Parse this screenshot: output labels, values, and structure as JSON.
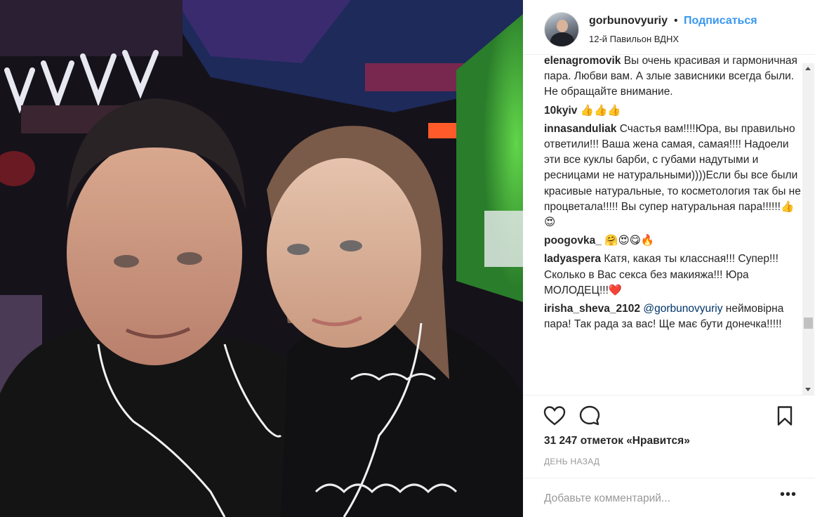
{
  "post": {
    "image_alt": "Селфи двух людей в студии"
  },
  "header": {
    "username": "gorbunovyuriy",
    "separator": "•",
    "follow_label": "Подписаться",
    "location": "12-й Павильон ВДНХ"
  },
  "comments": [
    {
      "user": "elenagromovik",
      "text": "Вы очень красивая и гармоничная пара. Любви вам. А злые зависники всегда были. Не обращайте внимание."
    },
    {
      "user": "10kyiv",
      "text": "👍👍👍"
    },
    {
      "user": "innasanduliak",
      "text": "Счастья вам!!!!Юра, вы правильно ответили!!! Ваша жена самая, самая!!!! Надоели эти все куклы барби, с губами надутыми и ресницами не натуральными))))Если бы все были красивые натуральные, то косметология так бы не процветала!!!!! Вы супер натуральная пара!!!!!!👍😍"
    },
    {
      "user": "poogovka_",
      "text": "🤗😍😋🔥"
    },
    {
      "user": "ladyaspera",
      "text": "Катя, какая ты классная!!! Супер!!! Сколько в Вас секса без макияжа!!! Юра МОЛОДЕЦ!!!❤️"
    },
    {
      "user": "irisha_sheva_2102",
      "mention": "@gorbunovyuriy",
      "text": "неймовірна пара! Так рада за вас! Ще має бути донечка!!!!!"
    }
  ],
  "actions": {
    "like_icon": "heart-icon",
    "comment_icon": "comment-icon",
    "save_icon": "bookmark-icon"
  },
  "likes": "31 247 отметок «Нравится»",
  "time": "ДЕНЬ НАЗАД",
  "add_comment": {
    "placeholder": "Добавьте комментарий...",
    "more_label": "•••"
  }
}
